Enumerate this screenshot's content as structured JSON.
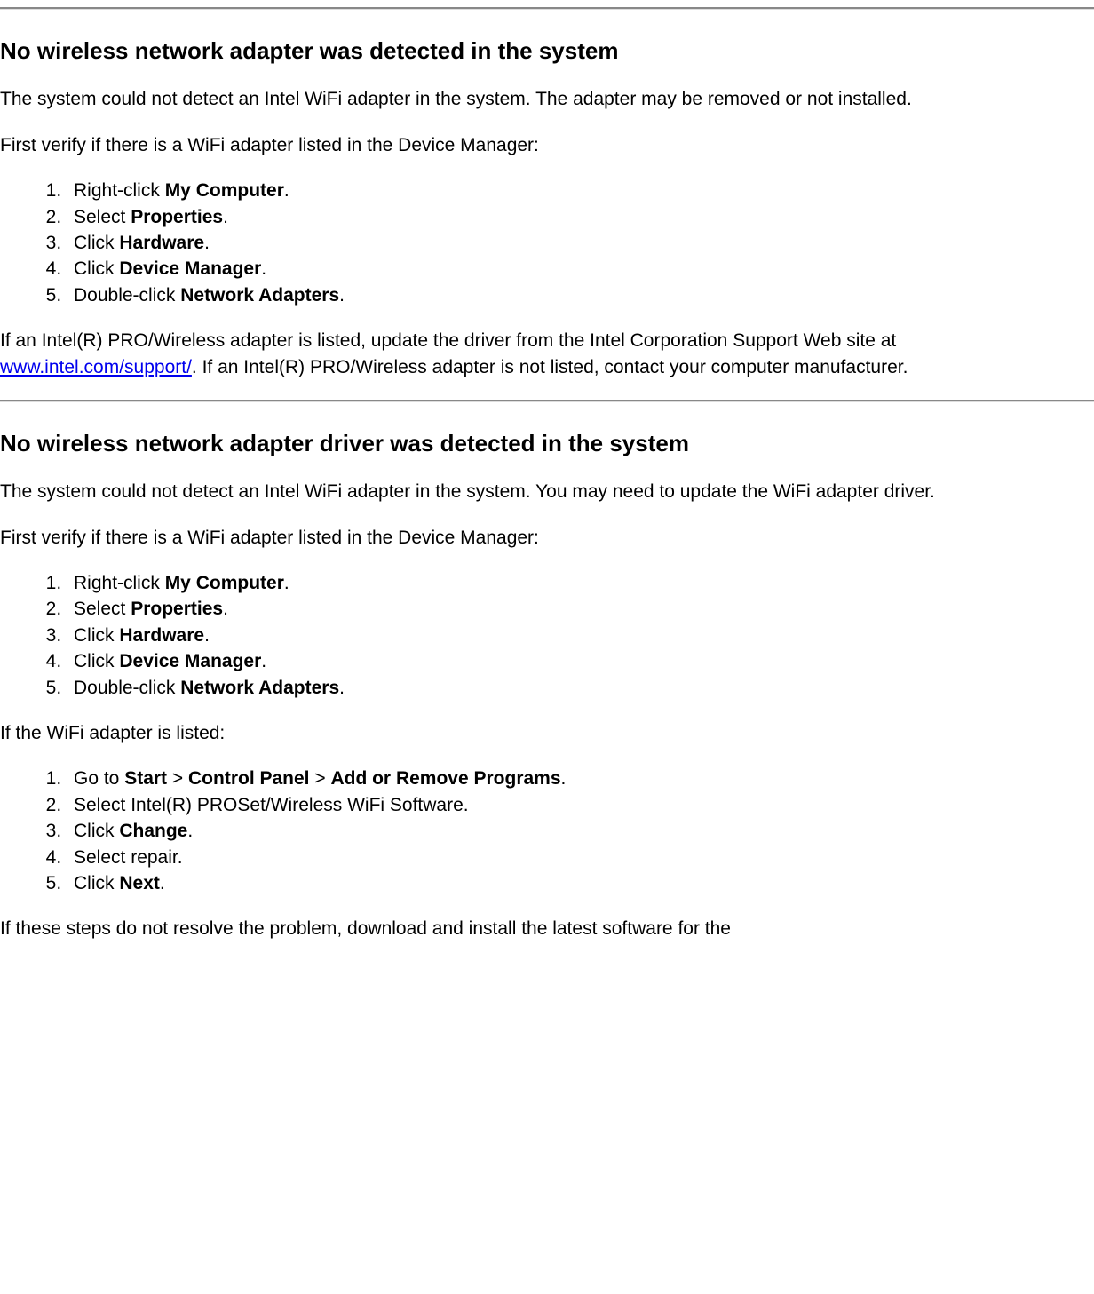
{
  "section1": {
    "heading": "No wireless network adapter was detected in the system",
    "para1": "The system could not detect an Intel WiFi adapter in the system. The adapter may be removed or not installed.",
    "para2": "First verify if there is a WiFi adapter listed in the Device Manager:",
    "steps": [
      {
        "pre": "Right-click ",
        "bold": "My Computer",
        "post": "."
      },
      {
        "pre": "Select ",
        "bold": "Properties",
        "post": "."
      },
      {
        "pre": "Click ",
        "bold": "Hardware",
        "post": "."
      },
      {
        "pre": "Click ",
        "bold": "Device Manager",
        "post": "."
      },
      {
        "pre": "Double-click ",
        "bold": "Network Adapters",
        "post": "."
      }
    ],
    "para3_pre": "If an Intel(R) PRO/Wireless adapter is listed, update the driver from the Intel Corporation Support Web site at ",
    "para3_link": "www.intel.com/support/",
    "para3_post": ". If an Intel(R) PRO/Wireless adapter is not listed, contact your computer manufacturer."
  },
  "section2": {
    "heading": "No wireless network adapter driver was detected in the system",
    "para1": "The system could not detect an Intel WiFi adapter in the system. You may need to update the WiFi adapter driver.",
    "para2": "First verify if there is a WiFi adapter listed in the Device Manager:",
    "stepsA": [
      {
        "pre": "Right-click ",
        "bold": "My Computer",
        "post": "."
      },
      {
        "pre": "Select ",
        "bold": "Properties",
        "post": "."
      },
      {
        "pre": "Click ",
        "bold": "Hardware",
        "post": "."
      },
      {
        "pre": "Click ",
        "bold": "Device Manager",
        "post": "."
      },
      {
        "pre": "Double-click ",
        "bold": "Network Adapters",
        "post": "."
      }
    ],
    "para3": "If the WiFi adapter is listed:",
    "stepsB": [
      {
        "pre": "Go to ",
        "bold": "Start",
        "mid1": " > ",
        "bold2": "Control Panel",
        "mid2": " > ",
        "bold3": "Add or Remove Programs",
        "post": "."
      },
      {
        "pre": "Select Intel(R) PROSet/Wireless WiFi Software.",
        "bold": "",
        "post": ""
      },
      {
        "pre": "Click ",
        "bold": "Change",
        "post": "."
      },
      {
        "pre": "Select repair.",
        "bold": "",
        "post": ""
      },
      {
        "pre": "Click ",
        "bold": "Next",
        "post": "."
      }
    ],
    "para4": "If these steps do not resolve the problem, download and install the latest software for the"
  }
}
